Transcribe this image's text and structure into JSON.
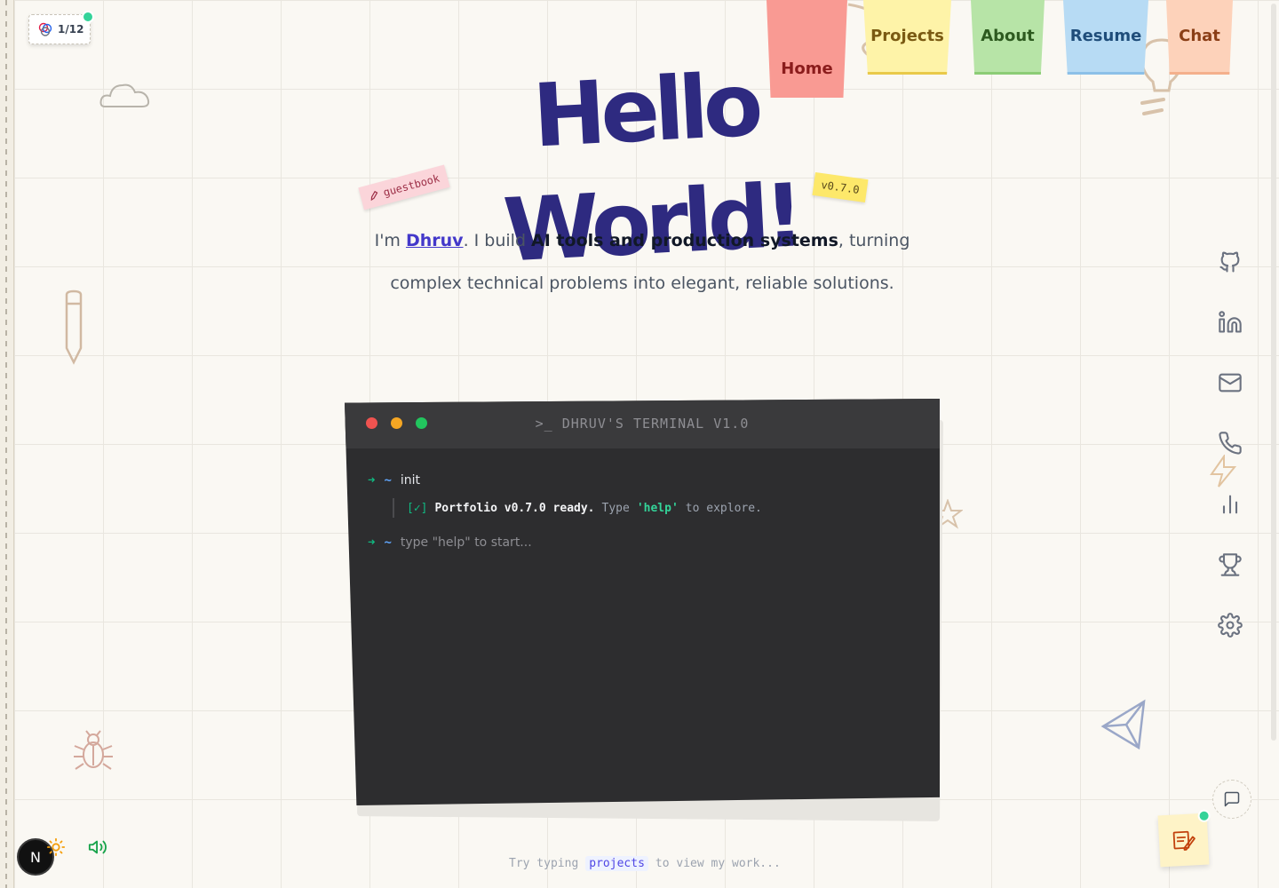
{
  "page_counter": {
    "value": "1/12"
  },
  "nav": {
    "tabs": [
      {
        "label": "Home"
      },
      {
        "label": "Projects"
      },
      {
        "label": "About"
      },
      {
        "label": "Resume"
      },
      {
        "label": "Chat"
      }
    ]
  },
  "hero": {
    "title": "Hello World!",
    "guestbook_label": "guestbook",
    "version_label": "v0.7.0"
  },
  "intro": {
    "prefix": "I'm ",
    "name": "Dhruv",
    "middle": ". I build ",
    "highlight": "AI tools and production systems",
    "suffix": ", turning complex technical problems into elegant, reliable solutions."
  },
  "terminal": {
    "title": ">_ DHRUV'S TERMINAL V1.0",
    "prompt_arrow": "➜",
    "prompt_path": "~",
    "first_command": "init",
    "output_check": "[✓]",
    "output_ready": "Portfolio v0.7.0 ready.",
    "output_type": "Type",
    "output_cmd": "'help'",
    "output_tail": "to explore.",
    "input_placeholder": "type \"help\" to start..."
  },
  "hint": {
    "prefix": "Try typing",
    "keyword": "projects",
    "suffix": "to view my work..."
  },
  "side_icons": [
    "github-icon",
    "linkedin-icon",
    "mail-icon",
    "phone-icon",
    "stats-icon",
    "trophy-icon",
    "settings-icon"
  ],
  "bottom": {
    "badge": "N"
  },
  "colors": {
    "title": "#2e2a80",
    "accent": "#4338ca",
    "terminal_bg": "#2d2d2f",
    "success": "#10b981"
  }
}
